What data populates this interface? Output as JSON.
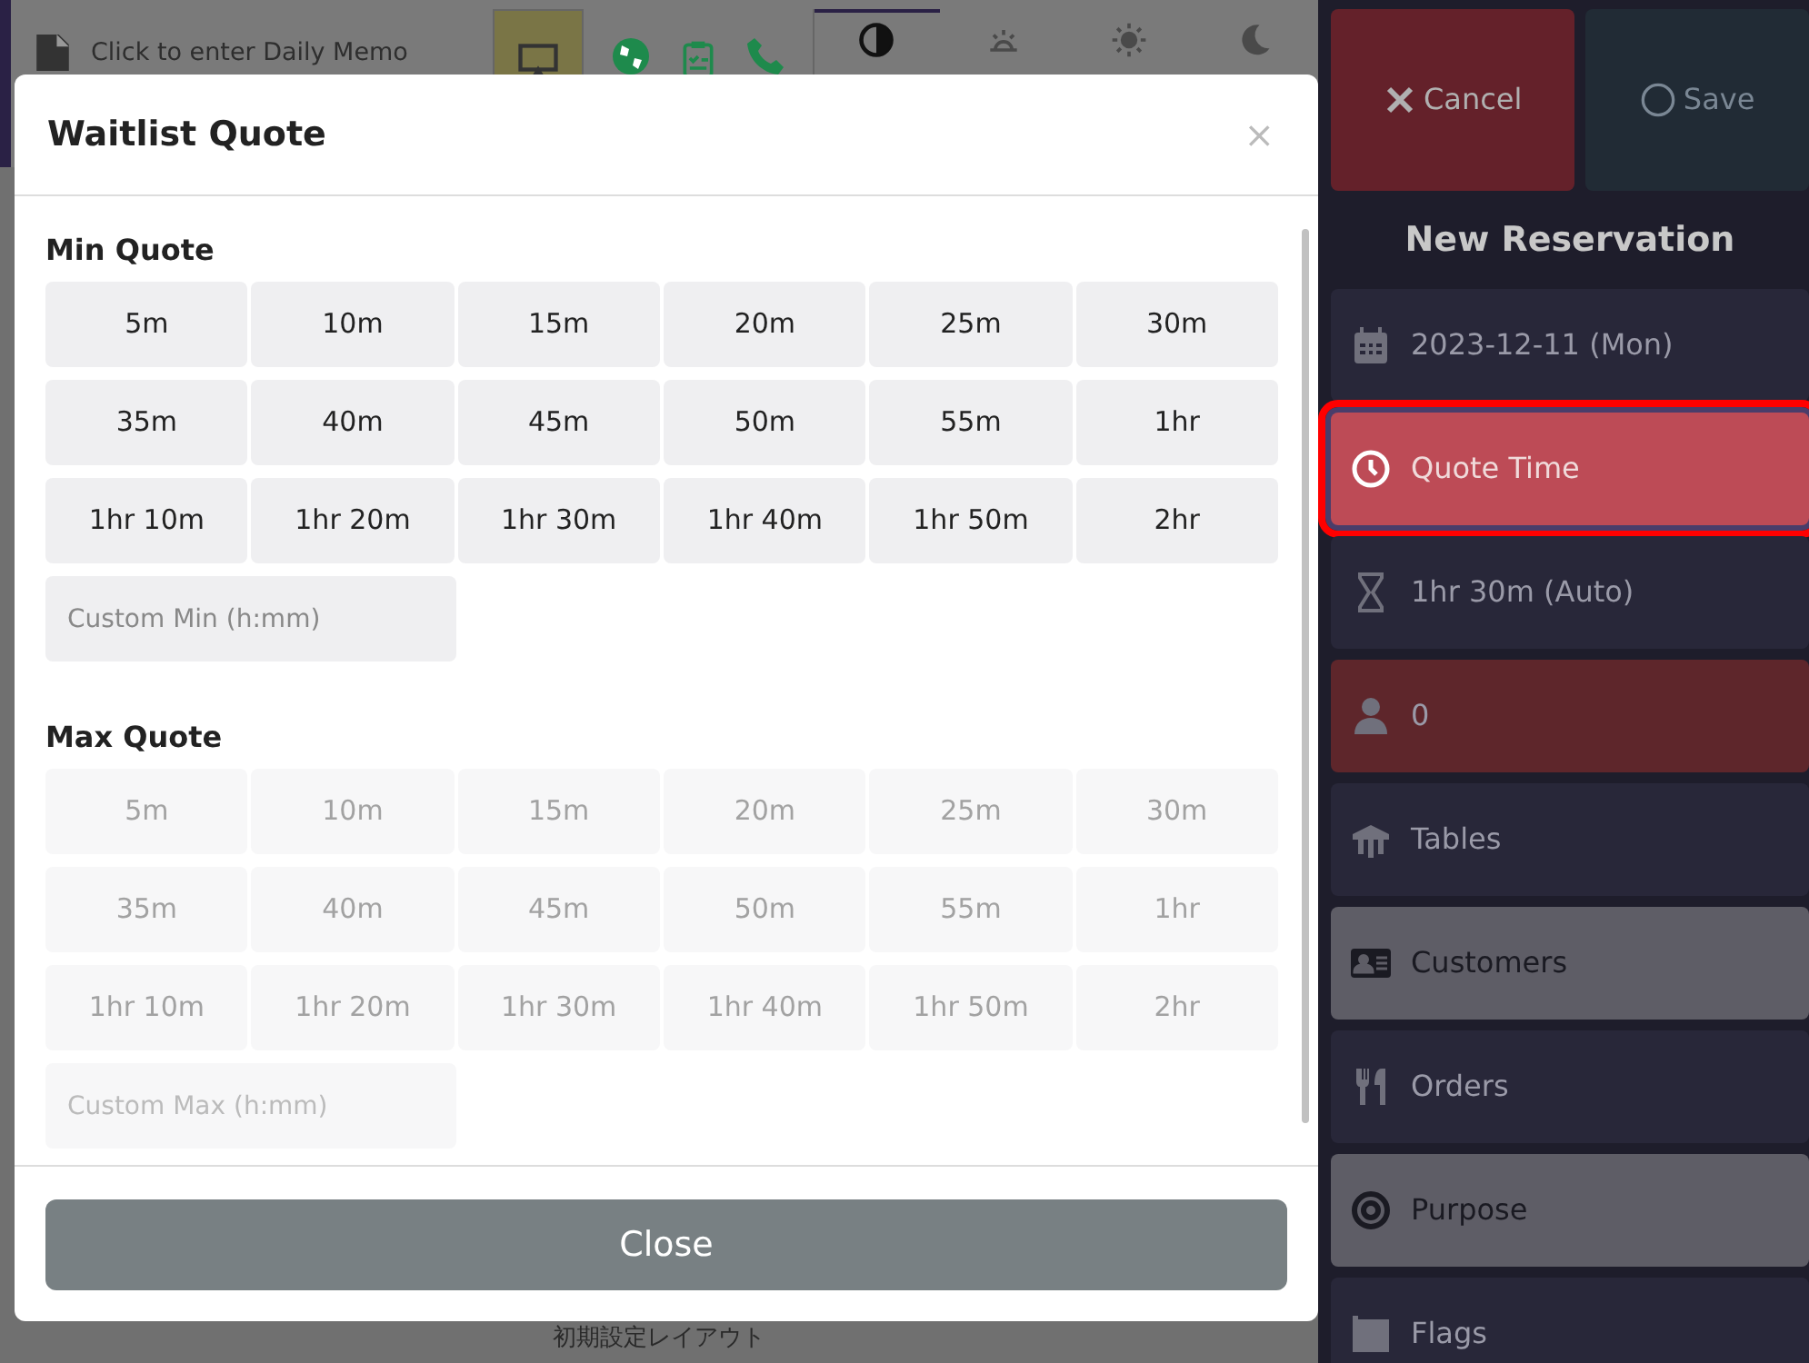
{
  "background": {
    "memo": "Click to enter Daily Memo",
    "meal_tabs": [
      {
        "kind": "allday",
        "selected": true
      },
      {
        "kind": "breakfast",
        "selected": false
      },
      {
        "kind": "lunch",
        "selected": false
      },
      {
        "kind": "dinner",
        "selected": false
      }
    ],
    "footer_label": "初期設定レイアウト"
  },
  "sidebar": {
    "cancel": "Cancel",
    "save": "Save",
    "title": "New Reservation",
    "items": [
      {
        "kind": "date",
        "label": "2023-12-11 (Mon)",
        "color": "#282739",
        "selected": false
      },
      {
        "kind": "quote",
        "label": "Quote Time",
        "color": "#bd4b56",
        "selected": true
      },
      {
        "kind": "duration",
        "label": "1hr 30m (Auto)",
        "color": "#282739",
        "selected": false
      },
      {
        "kind": "party",
        "label": "0",
        "color": "#5e262b",
        "selected": false
      },
      {
        "kind": "tables",
        "label": "Tables",
        "color": "#282739",
        "selected": false
      },
      {
        "kind": "customers",
        "label": "Customers",
        "color": "#5e5d66",
        "selected": false
      },
      {
        "kind": "orders",
        "label": "Orders",
        "color": "#282739",
        "selected": false
      },
      {
        "kind": "purpose",
        "label": "Purpose",
        "color": "#5e5d66",
        "selected": false
      },
      {
        "kind": "flags",
        "label": "Flags",
        "color": "#282739",
        "selected": false
      }
    ]
  },
  "modal": {
    "title": "Waitlist Quote",
    "close_icon": "×",
    "sections": [
      {
        "heading": "Min Quote",
        "disabled": false,
        "options": [
          "5m",
          "10m",
          "15m",
          "20m",
          "25m",
          "30m",
          "35m",
          "40m",
          "45m",
          "50m",
          "55m",
          "1hr",
          "1hr 10m",
          "1hr 20m",
          "1hr 30m",
          "1hr 40m",
          "1hr 50m",
          "2hr"
        ],
        "placeholder": "Custom Min (h:mm)"
      },
      {
        "heading": "Max Quote",
        "disabled": true,
        "options": [
          "5m",
          "10m",
          "15m",
          "20m",
          "25m",
          "30m",
          "35m",
          "40m",
          "45m",
          "50m",
          "55m",
          "1hr",
          "1hr 10m",
          "1hr 20m",
          "1hr 30m",
          "1hr 40m",
          "1hr 50m",
          "2hr"
        ],
        "placeholder": "Custom Max (h:mm)"
      }
    ],
    "close_button": "Close"
  }
}
